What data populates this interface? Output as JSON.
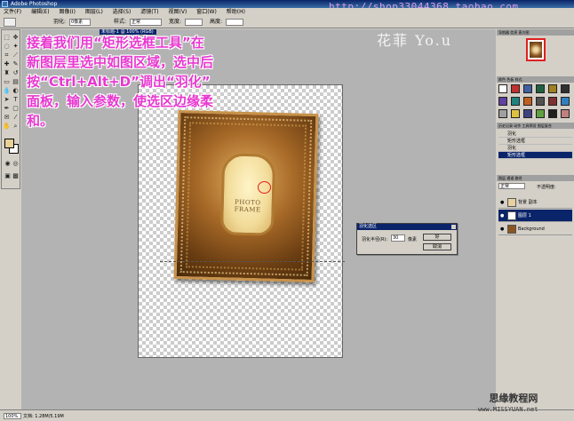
{
  "window": {
    "title": "Adobe Photoshop",
    "url_watermark": "http://shop33044368.taobao.com"
  },
  "menu": [
    "文件(F)",
    "编辑(E)",
    "图像(I)",
    "图层(L)",
    "选择(S)",
    "滤镜(T)",
    "视图(V)",
    "窗口(W)",
    "帮助(H)"
  ],
  "options": {
    "feather_label": "羽化:",
    "feather_value": "0像素",
    "style_label": "样式:",
    "style_value": "正常",
    "width_label": "宽度:",
    "height_label": "高度:"
  },
  "document": {
    "tab_title": "未标题-1 @ 100% (RGB)",
    "frame_text": "PHOTO FRAME"
  },
  "annotation": {
    "line1": "接着我们用“矩形选框工具”在",
    "line2": "新图层里选中如图区域，选中后",
    "line3": "按“Ctrl+Alt+D”调出“羽化”",
    "line4": "面板，输入参数，使选区边缘柔",
    "line5": "和。"
  },
  "logo": "花菲 Yo.u",
  "feather_dialog": {
    "title": "羽化选区",
    "label": "羽化半径(R):",
    "value": "30",
    "unit": "像素",
    "ok_label": "好",
    "cancel_label": "取消"
  },
  "panels": {
    "navigator_tab": "导航器 信息 直方图",
    "color_tab": "颜色 色板 样式",
    "history_tab": "历史记录 动作 工具预设 图层复合",
    "history_items": [
      "羽化",
      "矩形选框",
      "羽化",
      "矩形选框"
    ],
    "layers_tab": "图层 通道 路径",
    "blend_mode": "正常",
    "opacity_label": "不透明度:",
    "layers": [
      {
        "name": "背景 副本",
        "active": false
      },
      {
        "name": "图层 1",
        "active": true
      },
      {
        "name": "Background",
        "active": false
      }
    ]
  },
  "status": {
    "zoom": "100%",
    "doc_info": "文档: 1.28M/5.19M"
  },
  "site_watermark": {
    "name": "思缘教程网",
    "url": "www.MISSYUAN.net"
  },
  "colors": {
    "annotation": "#e838d0",
    "foreground_swatch": "#e8d098",
    "titlebar": "#0a246a"
  }
}
